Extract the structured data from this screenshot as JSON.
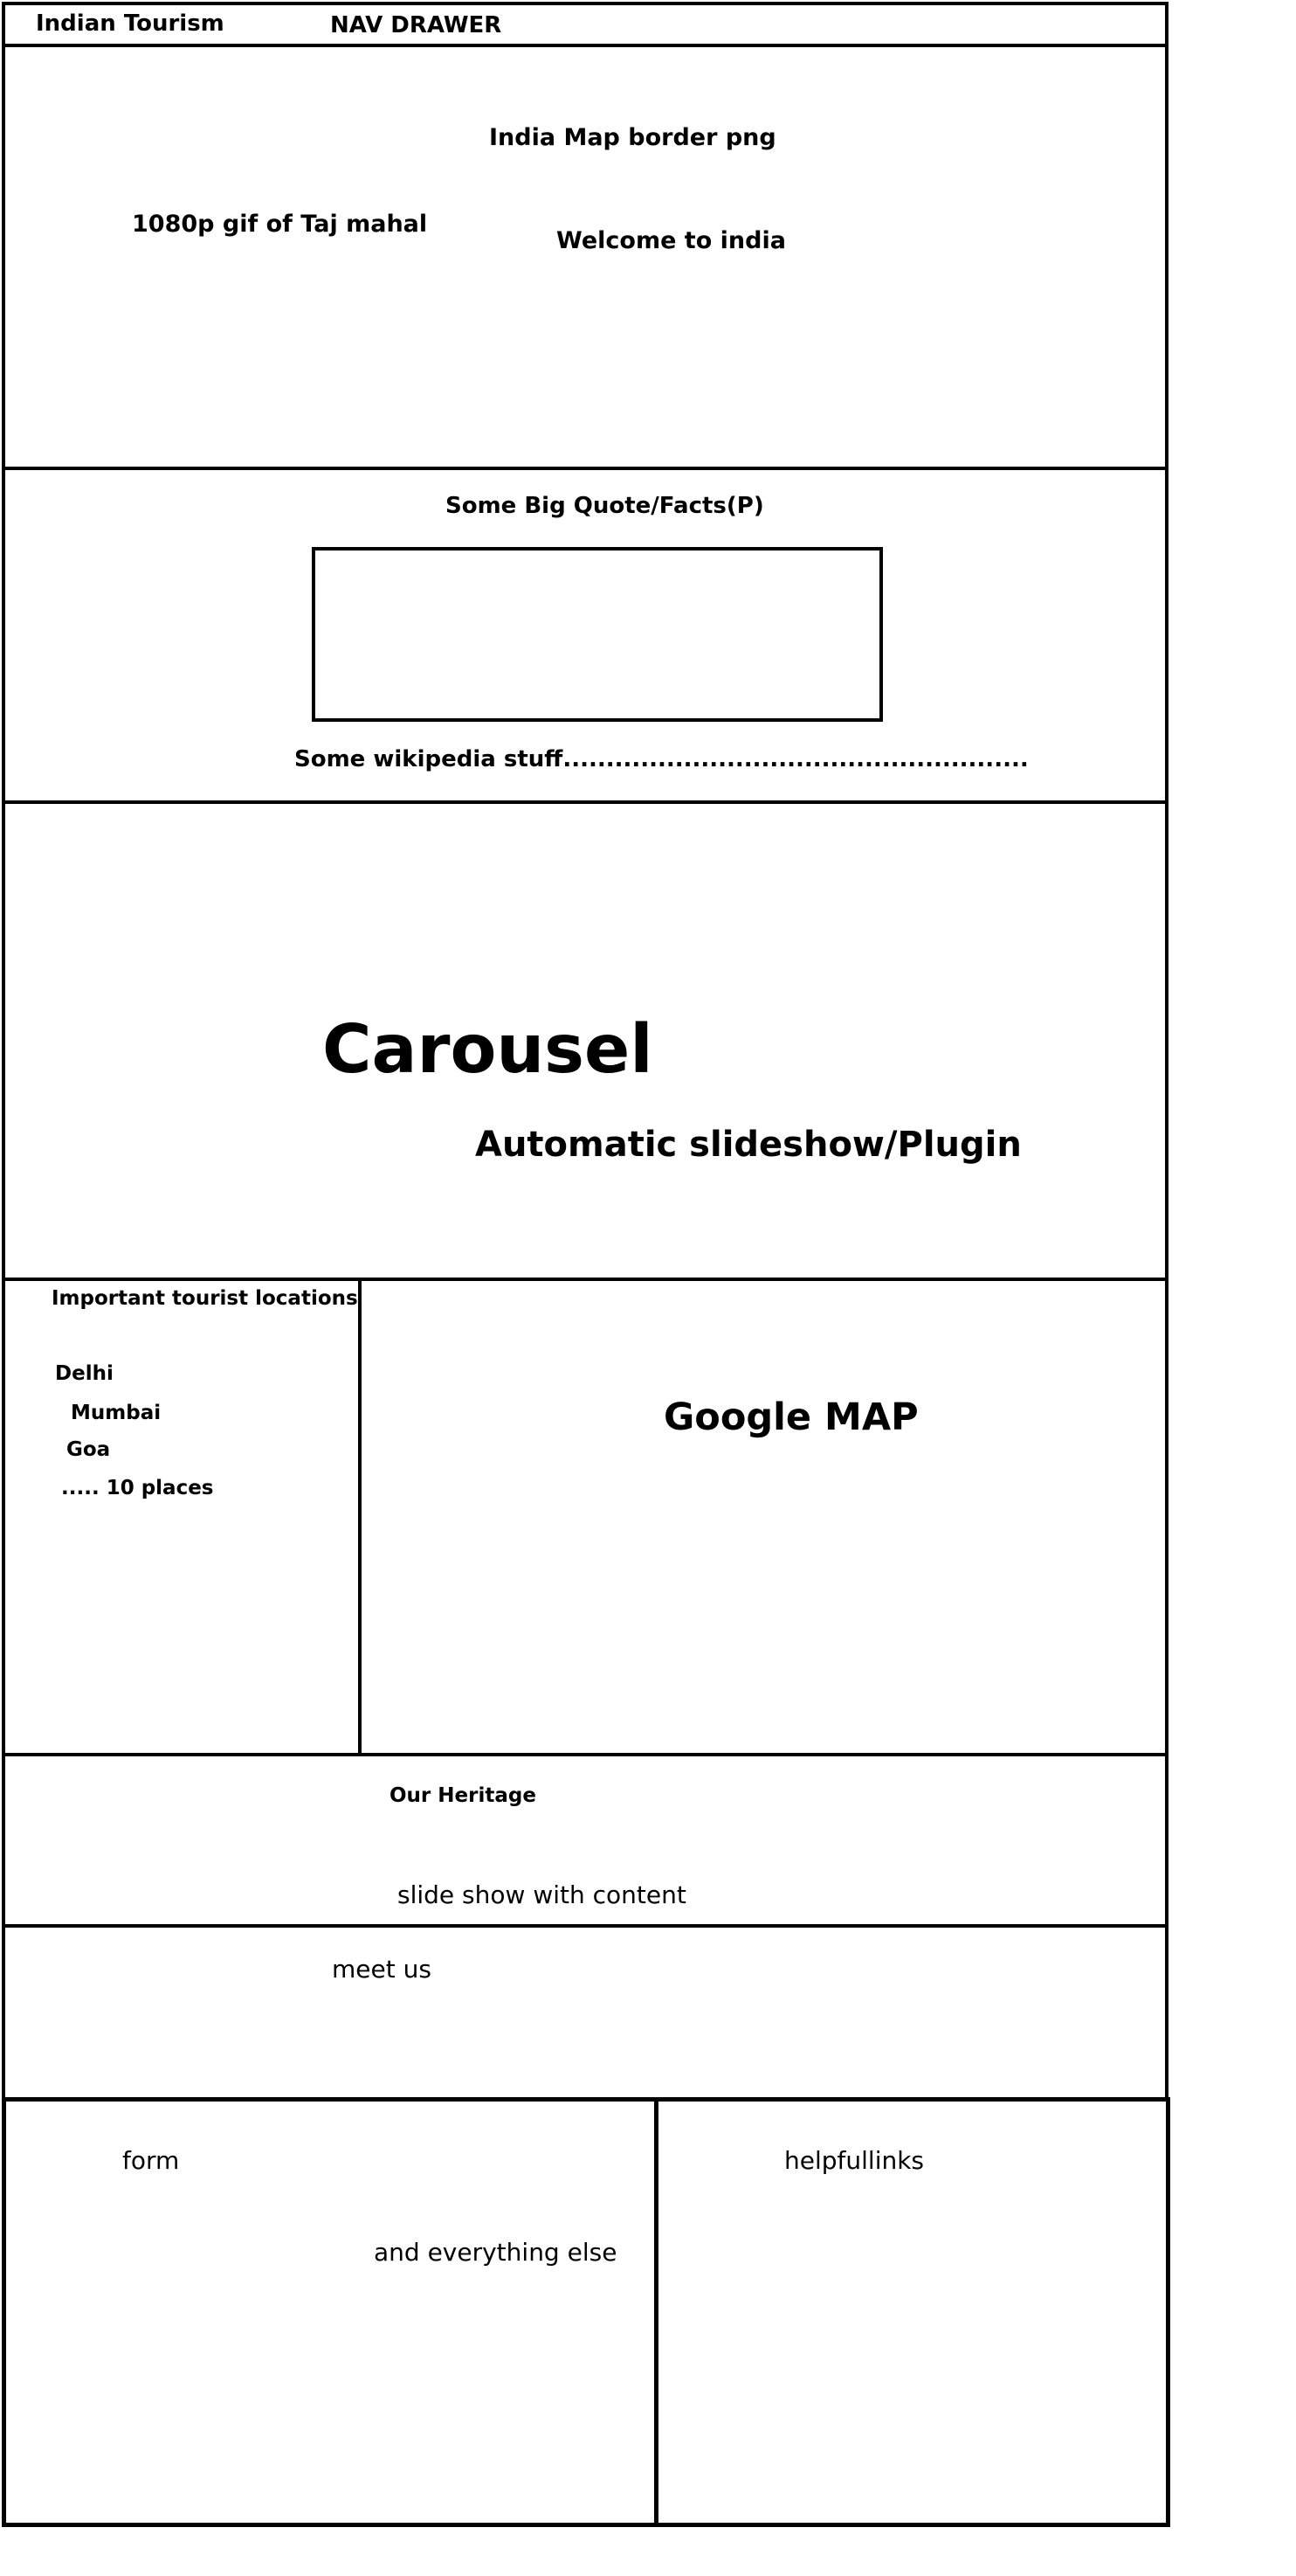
{
  "nav": {
    "brand": "Indian Tourism",
    "drawer_label": "NAV DRAWER"
  },
  "hero": {
    "map_label": "India Map border png",
    "gif_label": "1080p gif of Taj mahal",
    "welcome": "Welcome to india"
  },
  "quote": {
    "title": "Some Big Quote/Facts(P)",
    "wiki_text": "Some wikipedia stuff......................................................"
  },
  "carousel": {
    "title": "Carousel",
    "subtitle": "Automatic slideshow/Plugin"
  },
  "locations": {
    "heading": "Important tourist locations",
    "items": [
      "Delhi",
      "Mumbai",
      "Goa",
      "..... 10 places"
    ],
    "map_label": "Google MAP"
  },
  "heritage": {
    "title": "Our Heritage",
    "content": "slide show with content"
  },
  "meet": {
    "label": "meet us"
  },
  "footer": {
    "form_label": "form",
    "else_label": "and everything else",
    "links_label": "helpfullinks"
  }
}
